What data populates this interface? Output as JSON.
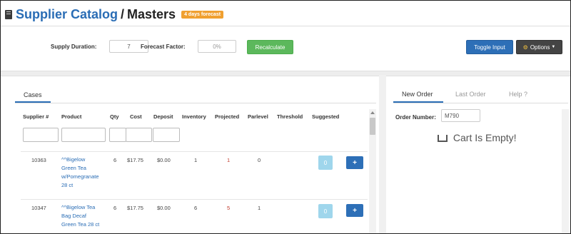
{
  "header": {
    "title_link": "Supplier Catalog",
    "separator": "/",
    "title_current": "Masters",
    "badge": "4 days forecast"
  },
  "toolbar": {
    "supply_duration_label": "Supply Duration:",
    "supply_duration_value": "7",
    "forecast_factor_label": "Forecast Factor:",
    "forecast_factor_placeholder": "0%",
    "recalculate_label": "Recalculate",
    "toggle_input_label": "Toggle Input",
    "options_label": "Options"
  },
  "left_tabs": {
    "cases_label": "Cases"
  },
  "table": {
    "columns": [
      "Supplier #",
      "Product",
      "Qty",
      "Cost",
      "Deposit",
      "Inventory",
      "Projected",
      "Parlevel",
      "Threshold",
      "Suggested"
    ],
    "rows": [
      {
        "supplier": "10363",
        "product_lines": [
          "^^Bigelow",
          "Green Tea",
          "w/Pomegranate",
          "28 ct"
        ],
        "qty": "6",
        "cost": "$17.75",
        "deposit": "$0.00",
        "inventory": "1",
        "projected": "1",
        "parlevel": "0",
        "threshold": "",
        "suggested": "0"
      },
      {
        "supplier": "10347",
        "product_lines": [
          "^^Bigelow Tea",
          "Bag Decaf",
          "Green Tea 28 ct"
        ],
        "qty": "6",
        "cost": "$17.75",
        "deposit": "$0.00",
        "inventory": "6",
        "projected": "5",
        "parlevel": "1",
        "threshold": "",
        "suggested": "0"
      }
    ],
    "add_label": "+"
  },
  "right_panel": {
    "tabs": [
      "New Order",
      "Last Order",
      "Help ?"
    ],
    "order_number_label": "Order Number:",
    "order_number_value": "M790",
    "cart_empty": "Cart Is Empty!"
  },
  "colors": {
    "link": "#2a6db5",
    "badge": "#f0a030",
    "recalculate": "#5cb85c",
    "toggle": "#2d6fb7",
    "options": "#444444",
    "suggested": "#9fd6ec"
  }
}
